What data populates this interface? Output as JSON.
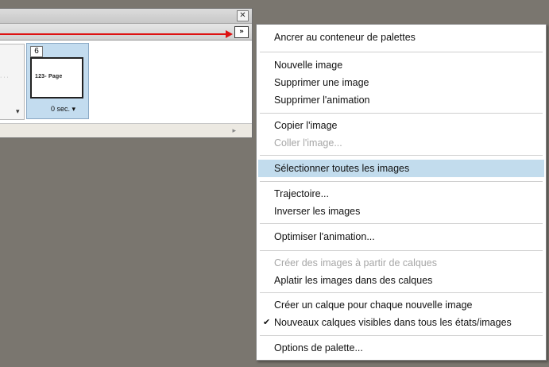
{
  "window": {
    "close_icon": "close-icon",
    "menu_button_glyph": "»",
    "frames": [
      {
        "delay_label": "▾"
      },
      {
        "number": "6",
        "thumbnail_text": "123- Page",
        "delay_label": "0 sec. ▾"
      }
    ],
    "scroll_arrow": "▸"
  },
  "menu": {
    "items": [
      {
        "label": "Ancrer au conteneur de palettes",
        "enabled": true
      },
      {
        "label": "Nouvelle image",
        "enabled": true
      },
      {
        "label": "Supprimer une image",
        "enabled": true
      },
      {
        "label": "Supprimer l'animation",
        "enabled": true
      },
      {
        "label": "Copier l'image",
        "enabled": true
      },
      {
        "label": "Coller l'image...",
        "enabled": false
      },
      {
        "label": "Sélectionner toutes les images",
        "enabled": true,
        "highlighted": true
      },
      {
        "label": "Trajectoire...",
        "enabled": true
      },
      {
        "label": "Inverser les images",
        "enabled": true
      },
      {
        "label": "Optimiser l'animation...",
        "enabled": true
      },
      {
        "label": "Créer des images à partir de calques",
        "enabled": false
      },
      {
        "label": "Aplatir les images dans des calques",
        "enabled": true
      },
      {
        "label": "Créer un calque pour chaque nouvelle image",
        "enabled": true
      },
      {
        "label": "Nouveaux calques visibles dans tous les états/images",
        "enabled": true,
        "checked": true
      },
      {
        "label": "Options de palette...",
        "enabled": true
      }
    ],
    "check_glyph": "✔"
  },
  "colors": {
    "highlight": "#c2dced",
    "annotation_arrow": "#dd1111",
    "background": "#7a766f"
  }
}
